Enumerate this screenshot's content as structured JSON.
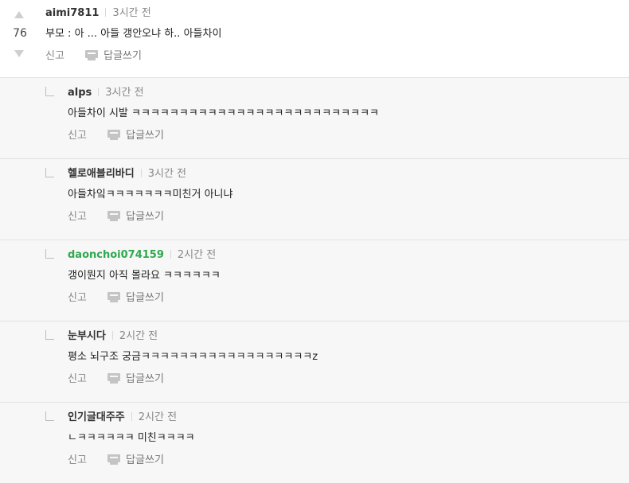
{
  "top_comment": {
    "votes": "76",
    "author": "aimi7811",
    "time": "3시간 전",
    "text": "부모 : 아 ... 아들 갱안오냐 하.. 아들차이",
    "report_label": "신고",
    "reply_label": "답글쓰기"
  },
  "replies": [
    {
      "author": "alps",
      "time": "3시간 전",
      "text": "아들차이 시발 ㅋㅋㅋㅋㅋㅋㅋㅋㅋㅋㅋㅋㅋㅋㅋㅋㅋㅋㅋㅋㅋㅋㅋㅋㅋㅋ",
      "report_label": "신고",
      "reply_label": "답글쓰기"
    },
    {
      "author": "헬로애블리바디",
      "time": "3시간 전",
      "text": "아들차잌ㅋㅋㅋㅋㅋㅋㅋ미친거 아니냐",
      "report_label": "신고",
      "reply_label": "답글쓰기"
    },
    {
      "author": "daonchoi074159",
      "time": "2시간 전",
      "text": "갱이뭔지 아직 몰라요 ㅋㅋㅋㅋㅋㅋ",
      "report_label": "신고",
      "reply_label": "답글쓰기"
    },
    {
      "author": "눈부시다",
      "time": "2시간 전",
      "text": "평소 뇌구조 궁금ㅋㅋㅋㅋㅋㅋㅋㅋㅋㅋㅋㅋㅋㅋㅋㅋㅋㅋz",
      "report_label": "신고",
      "reply_label": "답글쓰기"
    },
    {
      "author": "인기글대주주",
      "time": "2시간 전",
      "text": "ㄴㅋㅋㅋㅋㅋㅋ 미친ㅋㅋㅋㅋ",
      "report_label": "신고",
      "reply_label": "답글쓰기"
    }
  ],
  "colors": {
    "highlight_author": "#2fa84f",
    "reply_background": "#f7f7f7"
  },
  "icons": {
    "vote_up": "triangle-up-icon",
    "vote_down": "triangle-down-icon",
    "reply": "comment-bubble-icon"
  }
}
